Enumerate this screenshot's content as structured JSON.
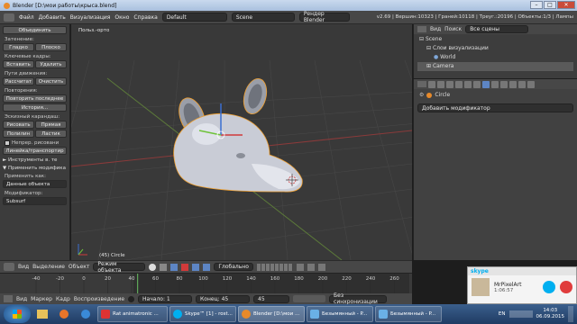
{
  "window": {
    "title": "Blender  [D:\\мои работы\\крыса.blend]",
    "min": "–",
    "max": "□",
    "close": "✕"
  },
  "topbar": {
    "menu": [
      "Файл",
      "Добавить",
      "Визуализация",
      "Окно",
      "Справка"
    ],
    "screen_layout": "Default",
    "scene": "Scene",
    "renderer": "Рендер Blender",
    "status": "v2.69 | Вершин:10323 | Граней:10118 | Треуг.:20196 | Объекты:1/3 | Лампы"
  },
  "toolshelf": {
    "join": "Объединить",
    "shading_label": "Затенение:",
    "smooth": "Гладко",
    "flat": "Плоско",
    "keyframes_label": "Ключевые кадры:",
    "insert": "Вставить",
    "delete": "Удалить",
    "motion_paths_label": "Пути движения:",
    "calculate": "Рассчитат",
    "clear": "Очистить",
    "repeat_label": "Повторения:",
    "repeat_last": "Повторить последнее",
    "history": "История...",
    "grease_label": "Эскизный карандаш:",
    "draw": "Рисовать",
    "line": "Прямая",
    "poly": "Полилин",
    "erase": "Ластик",
    "continuous": "Непрер. рисовани",
    "ruler": "Линейка/транспортир",
    "tools_panel": "► Инструменты в. те",
    "modifier_panel": "▼ Применить модифика",
    "apply_as_label": "Применить как:",
    "apply_as_value": "Данные объекта",
    "modifier_label": "Модификатор:",
    "modifier_value": "Subsurf"
  },
  "viewport": {
    "view_label": "Польз.-орто",
    "object_label": "(45) Circle"
  },
  "outliner": {
    "view": "Вид",
    "search": "Поиск",
    "scenes": "Все сцены",
    "items": [
      "Scene",
      "Слои визуализации",
      "World",
      "Camera"
    ]
  },
  "properties": {
    "object_name": "Circle",
    "add_modifier": "Добавить модификатор"
  },
  "viewport_header": {
    "view": "Вид",
    "select": "Выделение",
    "object": "Объект",
    "mode": "Режим объекта",
    "pivot": "Глобально"
  },
  "timeline": {
    "ticks": [
      "-40",
      "-20",
      "0",
      "20",
      "40",
      "60",
      "80",
      "100",
      "120",
      "140",
      "160",
      "180",
      "200",
      "220",
      "240",
      "260"
    ],
    "current_frame": "45",
    "menu": [
      "Вид",
      "Маркер",
      "Кадр",
      "Воспроизведение"
    ],
    "start": "Начало: 1",
    "end": "Конец: 45",
    "frame": "45",
    "sync": "Без синхронизации"
  },
  "skype": {
    "brand": "skype",
    "caller": "MrPixelArt",
    "duration": "1:06:57"
  },
  "taskbar": {
    "tasks": [
      "Rat animatronic ...",
      "Skype™ [1] - rost...",
      "Blender [D:\\мои ...",
      "Безымянный - P...",
      "Безымянный - P..."
    ],
    "lang": "EN",
    "time": "14:03",
    "date": "06.09.2015"
  },
  "colors": {
    "accent": "#e88a2a",
    "mesh": "#c9ccd6",
    "selection": "#f0a030",
    "x_axis": "#d03a3a",
    "y_axis": "#6ec23a",
    "z_axis": "#3a6ed0"
  }
}
